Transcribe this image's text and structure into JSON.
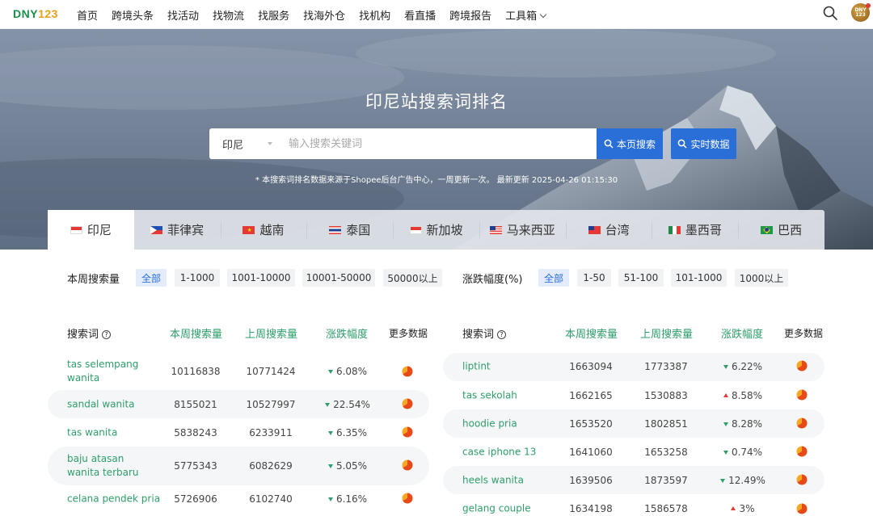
{
  "logo": {
    "brand": "DNY",
    "num": "123"
  },
  "nav": {
    "items": [
      "首页",
      "跨境头条",
      "找活动",
      "找物流",
      "找服务",
      "找海外仓",
      "找机构",
      "看直播",
      "跨境报告",
      "工具箱"
    ],
    "avatar_text": "DNY 123"
  },
  "hero": {
    "title": "印尼站搜索词排名",
    "selected_country": "印尼",
    "search_placeholder": "输入搜索关键词",
    "btn_page": "本页搜索",
    "btn_realtime": "实时数据",
    "note": "* 本搜索词排名数据来源于Shopee后台广告中心，一周更新一次。 最新更新 2025-04-26 01:15:30"
  },
  "tabs": [
    {
      "label": "印尼",
      "flag": "id"
    },
    {
      "label": "菲律宾",
      "flag": "ph"
    },
    {
      "label": "越南",
      "flag": "vn"
    },
    {
      "label": "泰国",
      "flag": "th"
    },
    {
      "label": "新加坡",
      "flag": "sg"
    },
    {
      "label": "马来西亚",
      "flag": "my"
    },
    {
      "label": "台湾",
      "flag": "tw"
    },
    {
      "label": "墨西哥",
      "flag": "mx"
    },
    {
      "label": "巴西",
      "flag": "br"
    }
  ],
  "filters": {
    "volume_label": "本周搜索量",
    "volume_options": [
      "全部",
      "1-1000",
      "1001-10000",
      "10001-50000",
      "50000以上"
    ],
    "change_label": "涨跌幅度(%)",
    "change_options": [
      "全部",
      "1-50",
      "51-100",
      "101-1000",
      "1000以上"
    ]
  },
  "table_headers": {
    "keyword": "搜索词",
    "this_week": "本周搜索量",
    "last_week": "上周搜索量",
    "change": "涨跌幅度",
    "more": "更多数据"
  },
  "left_rows": [
    {
      "keyword": "tas selempang wanita",
      "this_week": "10116838",
      "last_week": "10771424",
      "change": "6.08%",
      "dir": "down"
    },
    {
      "keyword": "sandal wanita",
      "this_week": "8155021",
      "last_week": "10527997",
      "change": "22.54%",
      "dir": "down"
    },
    {
      "keyword": "tas wanita",
      "this_week": "5838243",
      "last_week": "6233911",
      "change": "6.35%",
      "dir": "down"
    },
    {
      "keyword": "baju atasan wanita terbaru",
      "this_week": "5775343",
      "last_week": "6082629",
      "change": "5.05%",
      "dir": "down"
    },
    {
      "keyword": "celana pendek pria",
      "this_week": "5726906",
      "last_week": "6102740",
      "change": "6.16%",
      "dir": "down"
    }
  ],
  "right_rows": [
    {
      "keyword": "liptint",
      "this_week": "1663094",
      "last_week": "1773387",
      "change": "6.22%",
      "dir": "down"
    },
    {
      "keyword": "tas sekolah",
      "this_week": "1662165",
      "last_week": "1530883",
      "change": "8.58%",
      "dir": "up"
    },
    {
      "keyword": "hoodie pria",
      "this_week": "1653520",
      "last_week": "1802851",
      "change": "8.28%",
      "dir": "down"
    },
    {
      "keyword": "case iphone 13",
      "this_week": "1641060",
      "last_week": "1653258",
      "change": "0.74%",
      "dir": "down"
    },
    {
      "keyword": "heels wanita",
      "this_week": "1639506",
      "last_week": "1873597",
      "change": "12.49%",
      "dir": "down"
    },
    {
      "keyword": "gelang couple",
      "this_week": "1634198",
      "last_week": "1586578",
      "change": "3%",
      "dir": "up"
    }
  ],
  "colors": {
    "accent_blue": "#2a6fd8",
    "green": "#2e9e6a",
    "red": "#e53935"
  }
}
